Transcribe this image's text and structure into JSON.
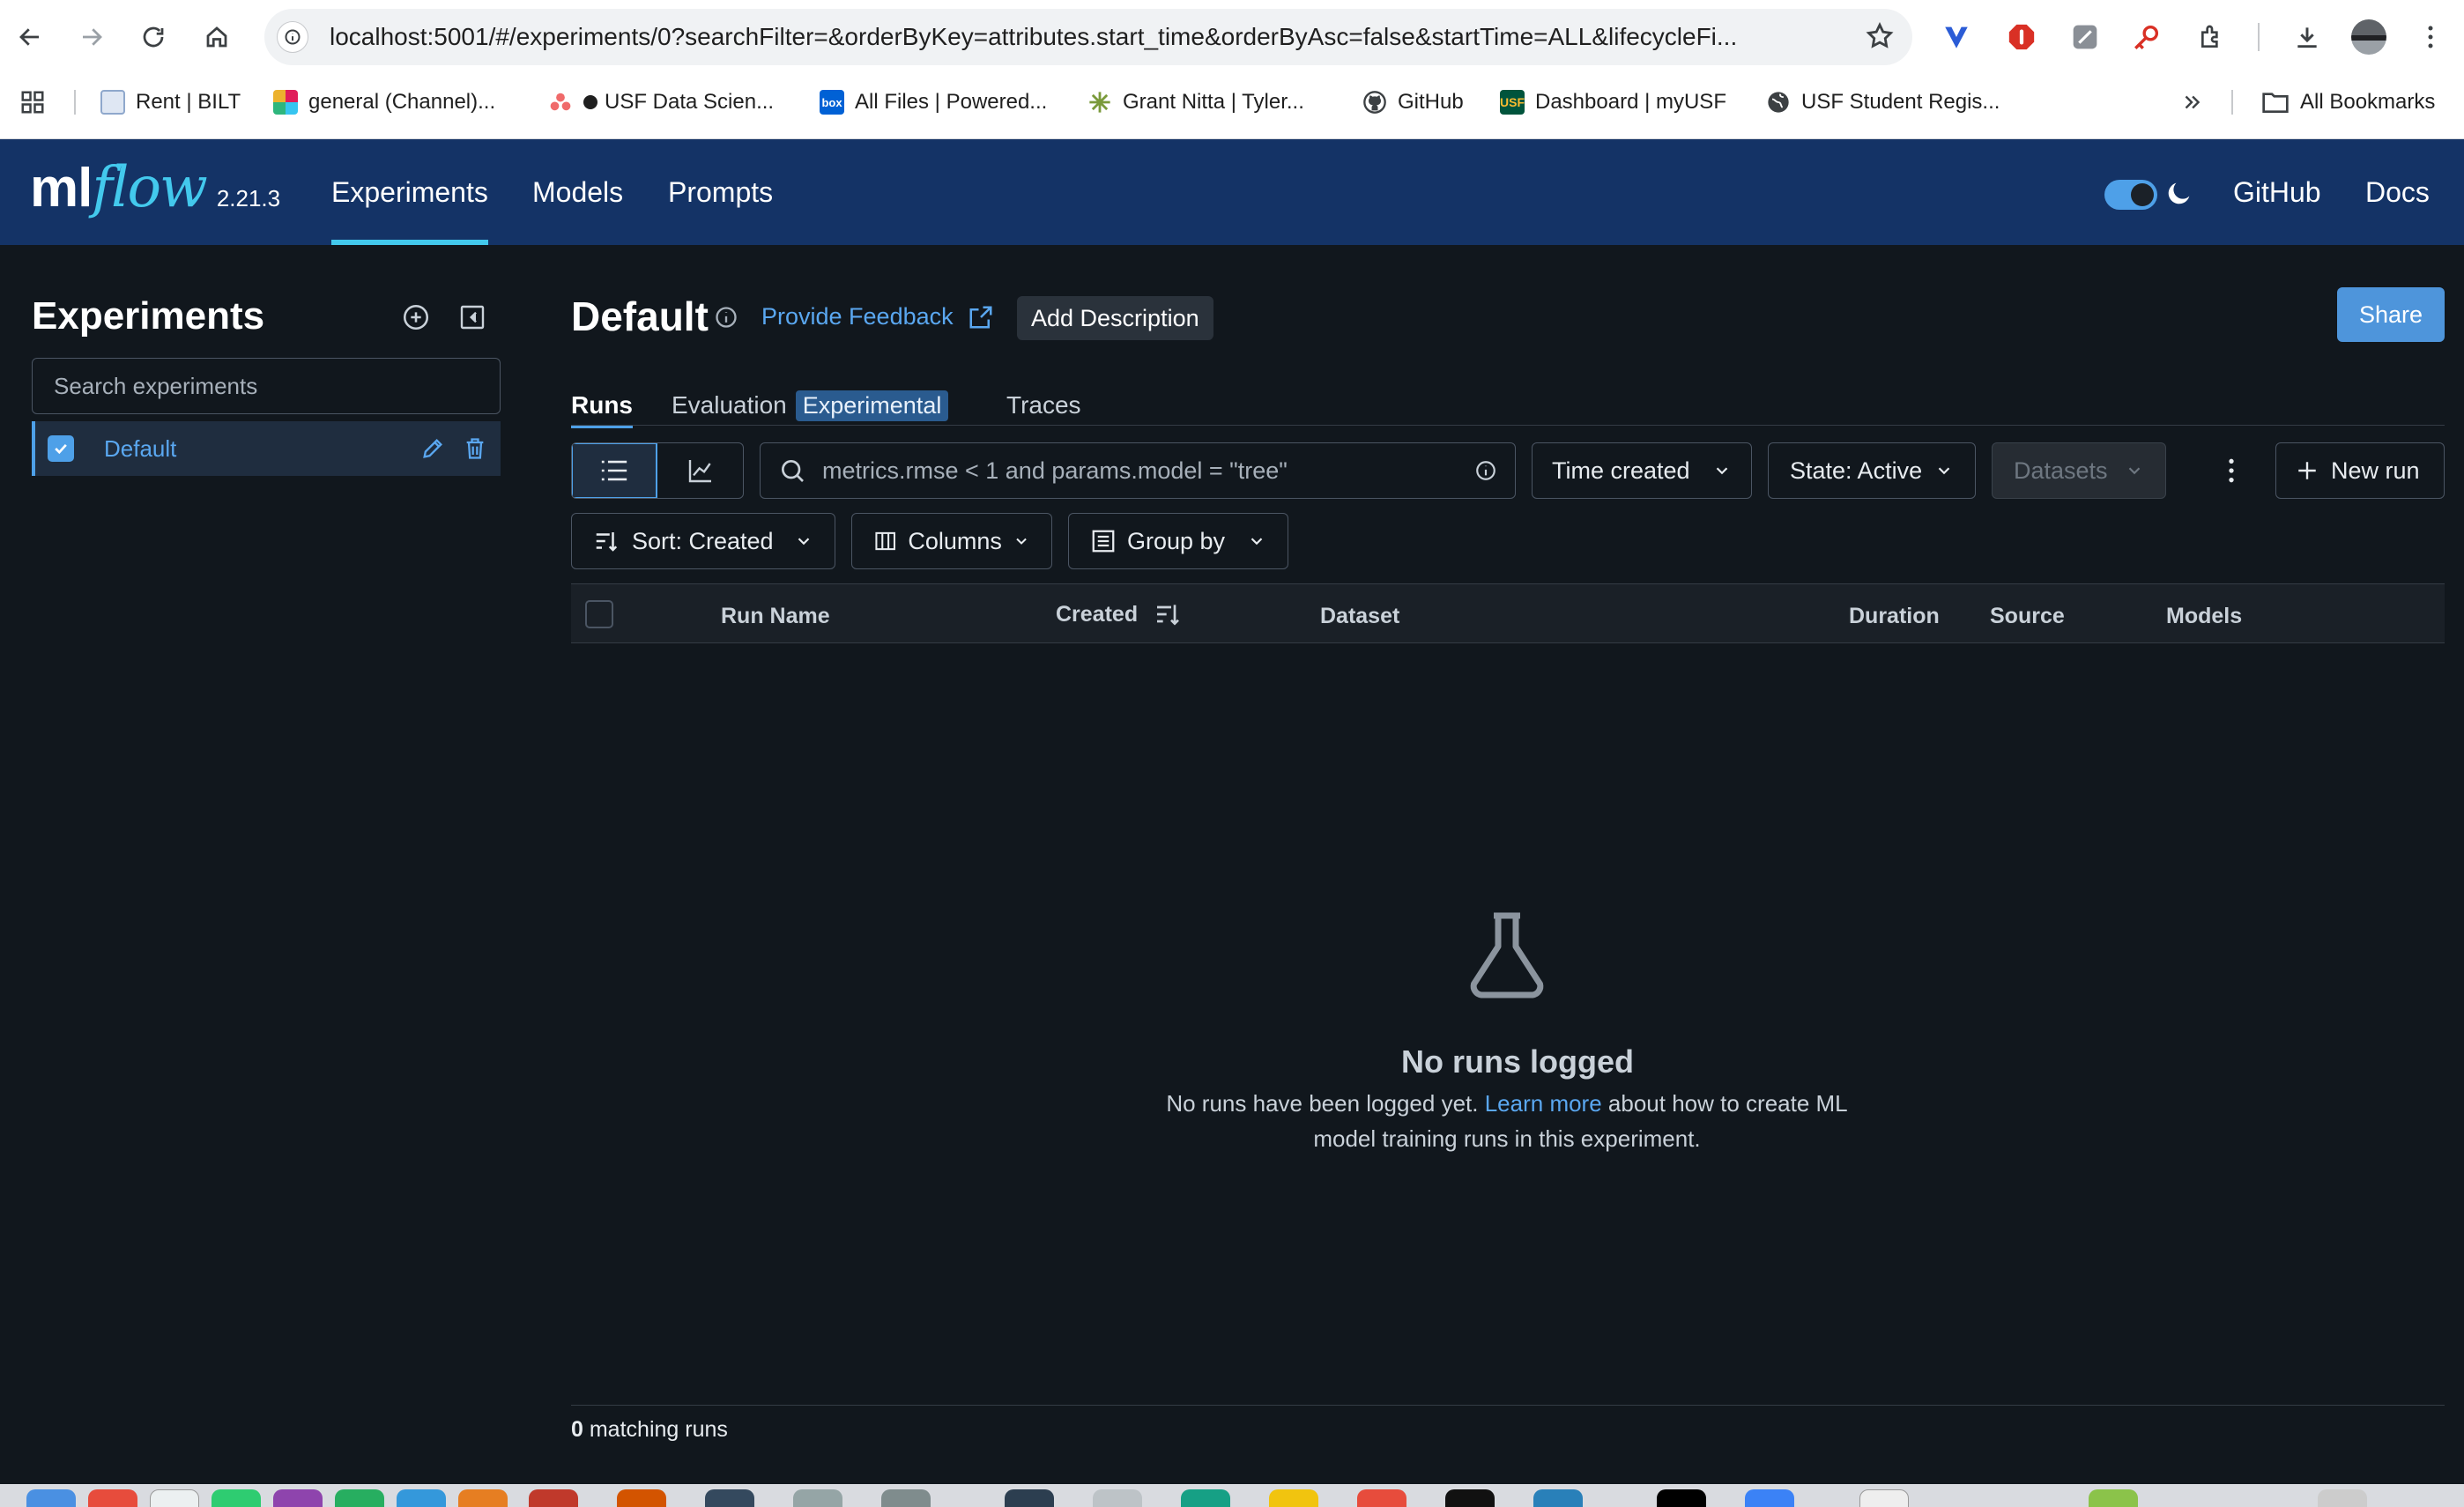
{
  "browser": {
    "url": "localhost:5001/#/experiments/0?searchFilter=&orderByKey=attributes.start_time&orderByAsc=false&startTime=ALL&lifecycleFi...",
    "bookmarks": [
      {
        "label": "Rent | BILT"
      },
      {
        "label": "general (Channel)..."
      },
      {
        "label": "USF Data Scien..."
      },
      {
        "label": "All Files | Powered..."
      },
      {
        "label": "Grant Nitta | Tyler..."
      },
      {
        "label": "GitHub"
      },
      {
        "label": "Dashboard | myUSF"
      },
      {
        "label": "USF Student Regis..."
      }
    ],
    "all_bookmarks": "All Bookmarks"
  },
  "header": {
    "logo_ml": "ml",
    "logo_flow": "flow",
    "version": "2.21.3",
    "nav": [
      "Experiments",
      "Models",
      "Prompts"
    ],
    "github": "GitHub",
    "docs": "Docs"
  },
  "sidebar": {
    "title": "Experiments",
    "search_placeholder": "Search experiments",
    "items": [
      {
        "label": "Default",
        "checked": true
      }
    ]
  },
  "main": {
    "title": "Default",
    "feedback": "Provide Feedback",
    "add_description": "Add Description",
    "share": "Share",
    "tabs": {
      "runs": "Runs",
      "evaluation": "Evaluation",
      "experimental": "Experimental",
      "traces": "Traces"
    },
    "search_placeholder": "metrics.rmse < 1 and params.model = \"tree\"",
    "time_created": "Time created",
    "state": "State: Active",
    "datasets": "Datasets",
    "new_run": "New run",
    "sort": "Sort: Created",
    "columns": "Columns",
    "group_by": "Group by",
    "table_columns": [
      "Run Name",
      "Created",
      "Dataset",
      "Duration",
      "Source",
      "Models"
    ],
    "empty_title": "No runs logged",
    "empty_desc_1": "No runs have been logged yet.",
    "empty_link": "Learn more",
    "empty_desc_2": "about how to create ML model training runs in this experiment.",
    "matching_count": "0",
    "matching_label": "matching runs"
  },
  "colors": {
    "header_bg": "#143366",
    "accent": "#43c9ed",
    "link": "#5aa7f0",
    "primary": "#4e95db",
    "page_bg": "#11171d"
  }
}
